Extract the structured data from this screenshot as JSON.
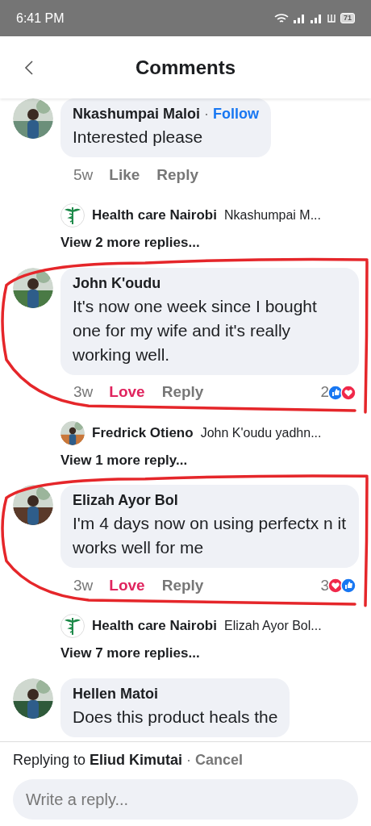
{
  "status_bar": {
    "time": "6:41 PM",
    "battery": "71"
  },
  "header": {
    "title": "Comments"
  },
  "comments": [
    {
      "author": "Nkashumpai Maloi",
      "separator": "·",
      "follow": "Follow",
      "text": "Interested please",
      "time": "5w",
      "reaction_label": "Like",
      "reacted": false,
      "reply_label": "Reply",
      "annotated": false,
      "reply_preview": {
        "kind": "logo",
        "author": "Health care Nairobi",
        "text": "Nkashumpai M..."
      },
      "more": "View 2 more replies..."
    },
    {
      "author": "John K'oudu",
      "text": "It's now one week since I bought one for my wife and it's really working well.",
      "time": "3w",
      "reaction_label": "Love",
      "reacted": true,
      "reply_label": "Reply",
      "annotated": true,
      "reaction_count": "2",
      "reactions": [
        {
          "kind": "like"
        },
        {
          "kind": "love"
        }
      ],
      "reply_preview": {
        "author": "Fredrick Otieno",
        "text": "John K'oudu yadhn..."
      },
      "more": "View 1 more reply..."
    },
    {
      "author": "Elizah Ayor Bol",
      "text": "I'm 4 days now on using perfectx n it works well for me",
      "time": "3w",
      "reaction_label": "Love",
      "reacted": true,
      "reply_label": "Reply",
      "annotated": true,
      "reaction_count": "3",
      "reactions": [
        {
          "kind": "love"
        },
        {
          "kind": "like"
        }
      ],
      "reply_preview": {
        "kind": "logo",
        "author": "Health care Nairobi",
        "text": "Elizah Ayor Bol..."
      },
      "more": "View 7 more replies..."
    },
    {
      "author": "Hellen Matoi",
      "text": "Does this product heals the",
      "annotated": false
    }
  ],
  "reply_bar": {
    "prefix": "Replying to",
    "target": "Eliud Kimutai",
    "separator": "·",
    "cancel": "Cancel",
    "placeholder": "Write a reply..."
  }
}
